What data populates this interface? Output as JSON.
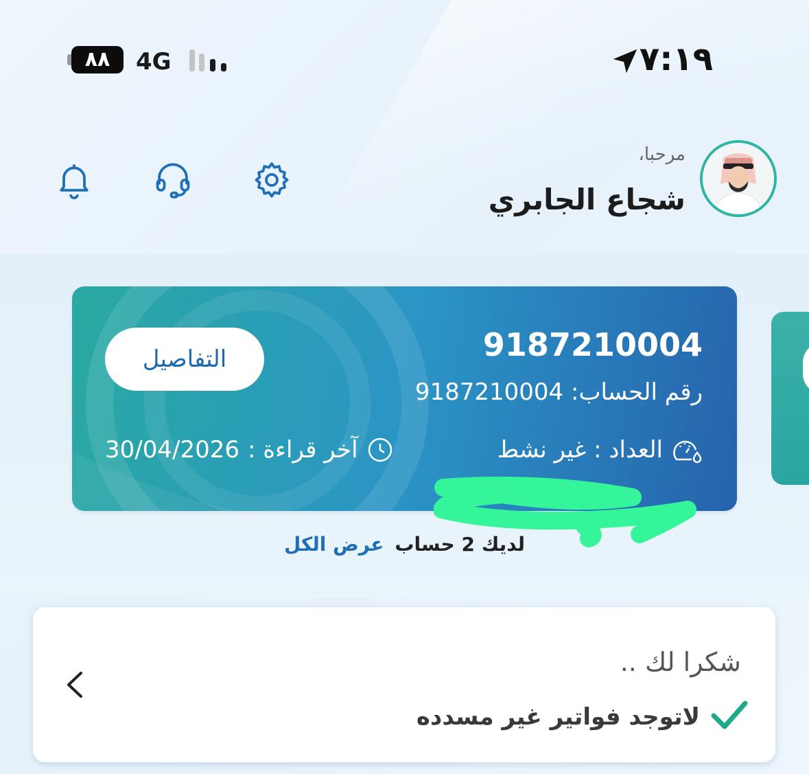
{
  "status_bar": {
    "time": "٧:١٩",
    "battery": "٨٨",
    "network": "4G"
  },
  "header": {
    "greeting": "مرحبا،",
    "user_name": "شجاع الجابري",
    "icons": [
      "settings-icon",
      "support-headset-icon",
      "notification-bell-icon"
    ]
  },
  "account_card": {
    "title": "9187210004",
    "account_number_label": "رقم الحساب:",
    "account_number": "9187210004",
    "meter_label": "العداد : غير نشط",
    "last_reading_label": "آخر قراءة :",
    "last_reading_date": "30/04/2026",
    "details_button": "التفاصيل"
  },
  "accounts": {
    "count_text": "لديك 2 حساب",
    "view_all": "عرض الكل"
  },
  "bills": {
    "thanks": "شكرا لك ..",
    "status": "لاتوجد فواتير غير مسدده"
  },
  "colors": {
    "accent_blue": "#1e6fb8",
    "teal": "#2fb5a3",
    "check_green": "#1fa98a"
  }
}
